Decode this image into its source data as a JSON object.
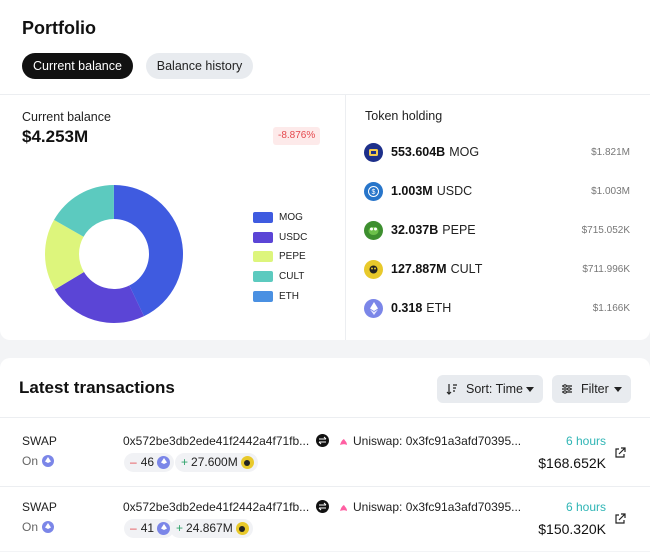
{
  "portfolio": {
    "title": "Portfolio",
    "tabs": [
      {
        "label": "Current balance",
        "active": true
      },
      {
        "label": "Balance history",
        "active": false
      }
    ],
    "balance_label": "Current balance",
    "balance_value": "$4.253M",
    "balance_change": "-8.876%",
    "chart_data": {
      "type": "pie",
      "categories": [
        "MOG",
        "USDC",
        "PEPE",
        "CULT",
        "ETH"
      ],
      "values": [
        1.821,
        1.003,
        0.715052,
        0.711996,
        0.001166
      ],
      "colors": [
        "#3f5be0",
        "#5b45d6",
        "#ddf57c",
        "#5ccabf",
        "#4a90e2"
      ]
    },
    "legend": [
      {
        "label": "MOG",
        "color": "#3f5be0"
      },
      {
        "label": "USDC",
        "color": "#5b45d6"
      },
      {
        "label": "PEPE",
        "color": "#ddf57c"
      },
      {
        "label": "CULT",
        "color": "#5ccabf"
      },
      {
        "label": "ETH",
        "color": "#4a90e2"
      }
    ],
    "token_holding_label": "Token holding",
    "tokens": [
      {
        "amount": "553.604B",
        "symbol": "MOG",
        "usd": "$1.821M",
        "icon": "mog-icon",
        "color": "#1d2f8a"
      },
      {
        "amount": "1.003M",
        "symbol": "USDC",
        "usd": "$1.003M",
        "icon": "usdc-icon",
        "color": "#2775ca"
      },
      {
        "amount": "32.037B",
        "symbol": "PEPE",
        "usd": "$715.052K",
        "icon": "pepe-icon",
        "color": "#3d8f2f"
      },
      {
        "amount": "127.887M",
        "symbol": "CULT",
        "usd": "$711.996K",
        "icon": "cult-icon",
        "color": "#e8c92b"
      },
      {
        "amount": "0.318",
        "symbol": "ETH",
        "usd": "$1.166K",
        "icon": "eth-icon",
        "color": "#7b86e8"
      }
    ]
  },
  "transactions": {
    "title": "Latest transactions",
    "sort_label": "Sort: Time",
    "filter_label": "Filter",
    "rows": [
      {
        "type": "SWAP",
        "chain": "On",
        "hash": "0x572be3db2ede41f2442a4f71fb...",
        "dex": "Uniswap: 0x3fc91a3afd70395...",
        "sent": "46",
        "received": "27.600M",
        "time": "6 hours",
        "usd": "$168.652K"
      },
      {
        "type": "SWAP",
        "chain": "On",
        "hash": "0x572be3db2ede41f2442a4f71fb...",
        "dex": "Uniswap: 0x3fc91a3afd70395...",
        "sent": "41",
        "received": "24.867M",
        "time": "6 hours",
        "usd": "$150.320K"
      }
    ]
  }
}
